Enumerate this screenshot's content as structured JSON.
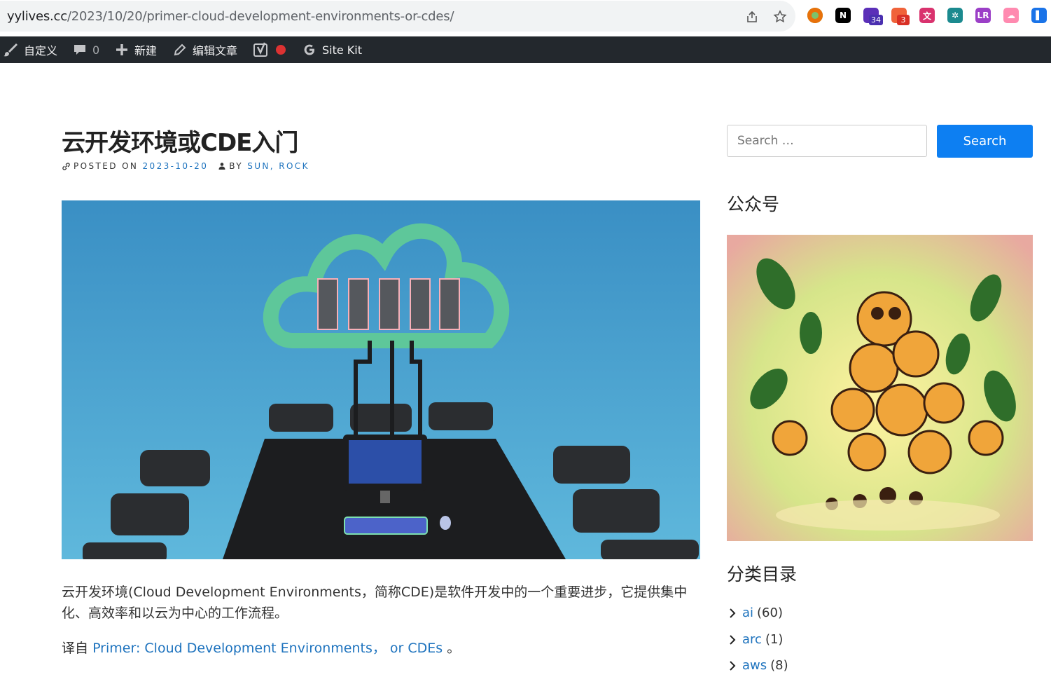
{
  "browser": {
    "url_host": "yylives.cc",
    "url_path": "/2023/10/20/primer-cloud-development-environments-or-cdes/",
    "extensions": [
      {
        "name": "circle-extension-icon",
        "color": "#e8710a"
      },
      {
        "name": "notion-extension-icon",
        "color": "#000000",
        "label": "N"
      },
      {
        "name": "graduation-cap-extension-icon",
        "color": "#5b2fb8",
        "badge": "34"
      },
      {
        "name": "cookie-extension-icon",
        "color": "#f0633a",
        "badge": "3"
      },
      {
        "name": "translate-extension-icon",
        "color": "#d9326e",
        "label": "文"
      },
      {
        "name": "grid-extension-icon",
        "color": "#1b8a8f",
        "label": "✲"
      },
      {
        "name": "lr-extension-icon",
        "color": "#9b3fc7",
        "label": "LR"
      },
      {
        "name": "cloud-extension-icon",
        "color": "#ff8ab0",
        "label": "☁"
      },
      {
        "name": "flag-extension-icon",
        "color": "#1a73e8",
        "label": "▌"
      }
    ]
  },
  "adminbar": {
    "customize": "自定义",
    "comments_count": "0",
    "new": "新建",
    "edit_post": "编辑文章",
    "sitekit": "Site Kit"
  },
  "post": {
    "title": "云开发环境或CDE入门",
    "posted_on_label": "POSTED ON",
    "date": "2023-10-20",
    "by_label": "BY",
    "author": "SUN, ROCK",
    "para1": "云开发环境(Cloud Development Environments，简称CDE)是软件开发中的一个重要进步，它提供集中化、高效率和以云为中心的工作流程。",
    "translated_from_label": "译自",
    "source_link": "Primer: Cloud Development Environments， or CDEs",
    "translated_suffix": "。"
  },
  "sidebar": {
    "search_placeholder": "Search …",
    "search_button": "Search",
    "wechat_title": "公众号",
    "categories_title": "分类目录",
    "categories": [
      {
        "name": "ai",
        "count": "(60)"
      },
      {
        "name": "arc",
        "count": "(1)"
      },
      {
        "name": "aws",
        "count": "(8)"
      }
    ]
  },
  "colors": {
    "link": "#1e73be",
    "search_button": "#0d7ff2",
    "adminbar": "#23282d"
  }
}
